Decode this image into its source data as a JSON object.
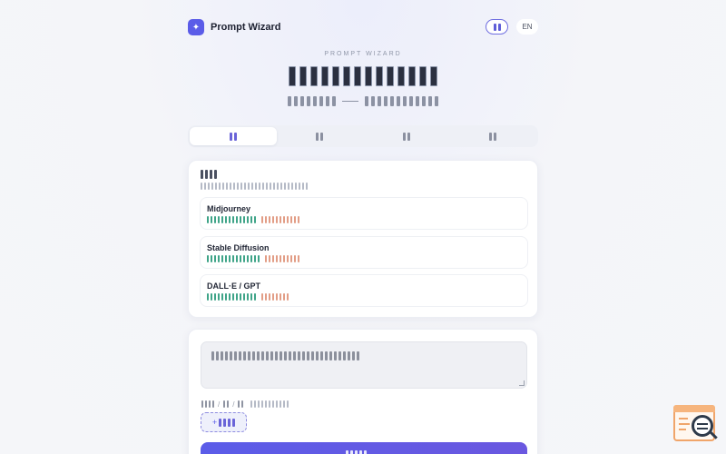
{
  "header": {
    "brand_name": "Prompt Wizard",
    "logo_icon": "sparkle-icon",
    "lang": "EN"
  },
  "hero": {
    "eyebrow": "PROMPT WIZARD"
  },
  "tabs": [
    {
      "state": "active"
    },
    {
      "state": "inactive"
    },
    {
      "state": "inactive"
    },
    {
      "state": "inactive"
    }
  ],
  "models": [
    {
      "name": "Midjourney"
    },
    {
      "name": "Stable Diffusion"
    },
    {
      "name": "DALL·E / GPT"
    }
  ],
  "composer": {
    "add_prefix": "+"
  },
  "colors": {
    "accent": "#5b5ce8",
    "tag_positive": "#3fa488",
    "tag_negative": "#e29d86"
  }
}
